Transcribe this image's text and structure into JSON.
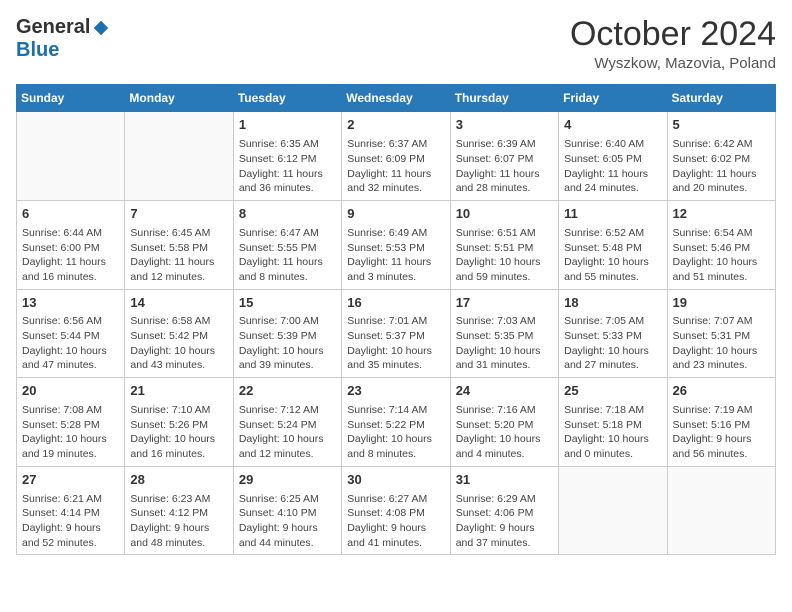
{
  "header": {
    "logo_general": "General",
    "logo_blue": "Blue",
    "month": "October 2024",
    "location": "Wyszkow, Mazovia, Poland"
  },
  "weekdays": [
    "Sunday",
    "Monday",
    "Tuesday",
    "Wednesday",
    "Thursday",
    "Friday",
    "Saturday"
  ],
  "weeks": [
    [
      {
        "day": "",
        "info": ""
      },
      {
        "day": "",
        "info": ""
      },
      {
        "day": "1",
        "info": "Sunrise: 6:35 AM\nSunset: 6:12 PM\nDaylight: 11 hours and 36 minutes."
      },
      {
        "day": "2",
        "info": "Sunrise: 6:37 AM\nSunset: 6:09 PM\nDaylight: 11 hours and 32 minutes."
      },
      {
        "day": "3",
        "info": "Sunrise: 6:39 AM\nSunset: 6:07 PM\nDaylight: 11 hours and 28 minutes."
      },
      {
        "day": "4",
        "info": "Sunrise: 6:40 AM\nSunset: 6:05 PM\nDaylight: 11 hours and 24 minutes."
      },
      {
        "day": "5",
        "info": "Sunrise: 6:42 AM\nSunset: 6:02 PM\nDaylight: 11 hours and 20 minutes."
      }
    ],
    [
      {
        "day": "6",
        "info": "Sunrise: 6:44 AM\nSunset: 6:00 PM\nDaylight: 11 hours and 16 minutes."
      },
      {
        "day": "7",
        "info": "Sunrise: 6:45 AM\nSunset: 5:58 PM\nDaylight: 11 hours and 12 minutes."
      },
      {
        "day": "8",
        "info": "Sunrise: 6:47 AM\nSunset: 5:55 PM\nDaylight: 11 hours and 8 minutes."
      },
      {
        "day": "9",
        "info": "Sunrise: 6:49 AM\nSunset: 5:53 PM\nDaylight: 11 hours and 3 minutes."
      },
      {
        "day": "10",
        "info": "Sunrise: 6:51 AM\nSunset: 5:51 PM\nDaylight: 10 hours and 59 minutes."
      },
      {
        "day": "11",
        "info": "Sunrise: 6:52 AM\nSunset: 5:48 PM\nDaylight: 10 hours and 55 minutes."
      },
      {
        "day": "12",
        "info": "Sunrise: 6:54 AM\nSunset: 5:46 PM\nDaylight: 10 hours and 51 minutes."
      }
    ],
    [
      {
        "day": "13",
        "info": "Sunrise: 6:56 AM\nSunset: 5:44 PM\nDaylight: 10 hours and 47 minutes."
      },
      {
        "day": "14",
        "info": "Sunrise: 6:58 AM\nSunset: 5:42 PM\nDaylight: 10 hours and 43 minutes."
      },
      {
        "day": "15",
        "info": "Sunrise: 7:00 AM\nSunset: 5:39 PM\nDaylight: 10 hours and 39 minutes."
      },
      {
        "day": "16",
        "info": "Sunrise: 7:01 AM\nSunset: 5:37 PM\nDaylight: 10 hours and 35 minutes."
      },
      {
        "day": "17",
        "info": "Sunrise: 7:03 AM\nSunset: 5:35 PM\nDaylight: 10 hours and 31 minutes."
      },
      {
        "day": "18",
        "info": "Sunrise: 7:05 AM\nSunset: 5:33 PM\nDaylight: 10 hours and 27 minutes."
      },
      {
        "day": "19",
        "info": "Sunrise: 7:07 AM\nSunset: 5:31 PM\nDaylight: 10 hours and 23 minutes."
      }
    ],
    [
      {
        "day": "20",
        "info": "Sunrise: 7:08 AM\nSunset: 5:28 PM\nDaylight: 10 hours and 19 minutes."
      },
      {
        "day": "21",
        "info": "Sunrise: 7:10 AM\nSunset: 5:26 PM\nDaylight: 10 hours and 16 minutes."
      },
      {
        "day": "22",
        "info": "Sunrise: 7:12 AM\nSunset: 5:24 PM\nDaylight: 10 hours and 12 minutes."
      },
      {
        "day": "23",
        "info": "Sunrise: 7:14 AM\nSunset: 5:22 PM\nDaylight: 10 hours and 8 minutes."
      },
      {
        "day": "24",
        "info": "Sunrise: 7:16 AM\nSunset: 5:20 PM\nDaylight: 10 hours and 4 minutes."
      },
      {
        "day": "25",
        "info": "Sunrise: 7:18 AM\nSunset: 5:18 PM\nDaylight: 10 hours and 0 minutes."
      },
      {
        "day": "26",
        "info": "Sunrise: 7:19 AM\nSunset: 5:16 PM\nDaylight: 9 hours and 56 minutes."
      }
    ],
    [
      {
        "day": "27",
        "info": "Sunrise: 6:21 AM\nSunset: 4:14 PM\nDaylight: 9 hours and 52 minutes."
      },
      {
        "day": "28",
        "info": "Sunrise: 6:23 AM\nSunset: 4:12 PM\nDaylight: 9 hours and 48 minutes."
      },
      {
        "day": "29",
        "info": "Sunrise: 6:25 AM\nSunset: 4:10 PM\nDaylight: 9 hours and 44 minutes."
      },
      {
        "day": "30",
        "info": "Sunrise: 6:27 AM\nSunset: 4:08 PM\nDaylight: 9 hours and 41 minutes."
      },
      {
        "day": "31",
        "info": "Sunrise: 6:29 AM\nSunset: 4:06 PM\nDaylight: 9 hours and 37 minutes."
      },
      {
        "day": "",
        "info": ""
      },
      {
        "day": "",
        "info": ""
      }
    ]
  ]
}
